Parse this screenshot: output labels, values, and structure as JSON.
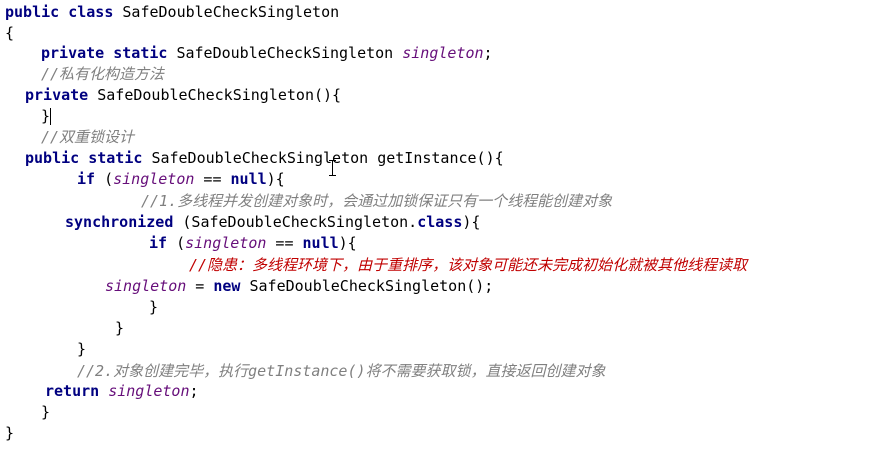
{
  "code": {
    "l1": {
      "kw1": "public",
      "kw2": "class",
      "name": "SafeDoubleCheckSingleton"
    },
    "l2": {
      "text": "{"
    },
    "l3": {
      "kw1": "private",
      "kw2": "static",
      "type": "SafeDoubleCheckSingleton",
      "field": "singleton",
      "end": ";"
    },
    "l4": {
      "comment": "//私有化构造方法"
    },
    "l5": {
      "kw1": "private",
      "text": "SafeDoubleCheckSingleton(){"
    },
    "l6": {
      "text": "}"
    },
    "l7": {
      "comment": "//双重锁设计"
    },
    "l8": {
      "kw1": "public",
      "kw2": "static",
      "text": "SafeDoubleCheckSingleton getInstance(){"
    },
    "l9": {
      "kw1": "if",
      "open": "(",
      "field": "singleton",
      "op": " == ",
      "kw2": "null",
      "close": "){"
    },
    "l10": {
      "comment": "//1.多线程并发创建对象时，会通过加锁保证只有一个线程能创建对象"
    },
    "l11": {
      "kw1": "synchronized",
      "text": " (SafeDoubleCheckSingleton.",
      "kw2": "class",
      "close": "){"
    },
    "l12": {
      "kw1": "if",
      "open": "(",
      "field": "singleton",
      "op": " == ",
      "kw2": "null",
      "close": "){"
    },
    "l13": {
      "comment": "//隐患：多线程环境下，由于重排序，该对象可能还未完成初始化就被其他线程读取"
    },
    "l14": {
      "field": "singleton",
      "op": " = ",
      "kw1": "new",
      "text": " SafeDoubleCheckSingleton();"
    },
    "l15": {
      "text": "}"
    },
    "l16": {
      "text": "}"
    },
    "l17": {
      "text": "}"
    },
    "l18": {
      "comment": "//2.对象创建完毕，执行getInstance()将不需要获取锁，直接返回创建对象"
    },
    "l19": {
      "kw1": "return",
      "field": "singleton",
      "end": ";"
    },
    "l20": {
      "text": "}"
    },
    "l21": {
      "text": "}"
    }
  },
  "colors": {
    "keyword": "#000080",
    "field": "#660e7a",
    "comment": "#808080",
    "warning_comment": "#c00000",
    "background": "#ffffff"
  }
}
